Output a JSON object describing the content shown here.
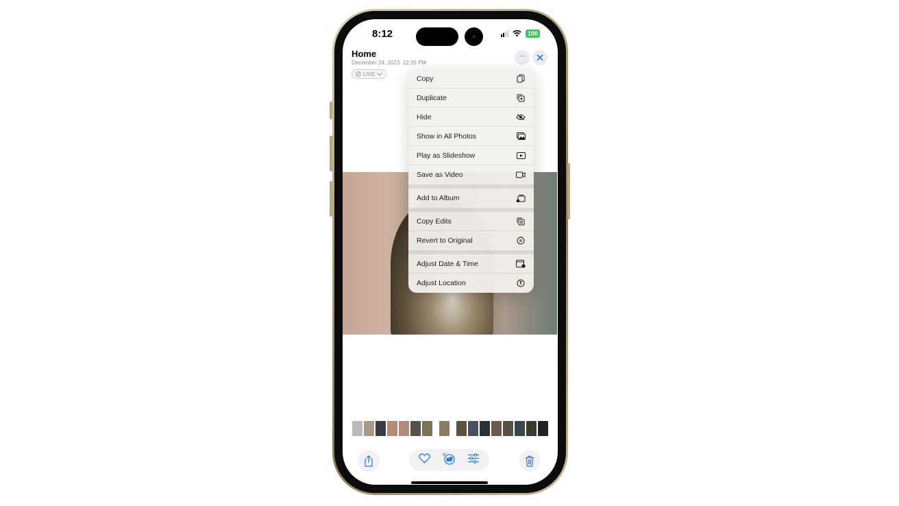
{
  "status_bar": {
    "time": "8:12",
    "battery": "100",
    "battery_color": "#34c759"
  },
  "header": {
    "title": "Home",
    "date": "December 24, 2023",
    "time": "12:26 PM",
    "live_label": "LIVE",
    "more_icon": "ellipsis-icon",
    "close_icon": "close-icon"
  },
  "menu": {
    "groups": [
      [
        {
          "label": "Copy",
          "icon": "copy-icon"
        },
        {
          "label": "Duplicate",
          "icon": "duplicate-icon"
        },
        {
          "label": "Hide",
          "icon": "eye-slash-icon"
        },
        {
          "label": "Show in All Photos",
          "icon": "photos-icon"
        },
        {
          "label": "Play as Slideshow",
          "icon": "play-rectangle-icon"
        },
        {
          "label": "Save as Video",
          "icon": "video-icon"
        }
      ],
      [
        {
          "label": "Add to Album",
          "icon": "add-album-icon"
        }
      ],
      [
        {
          "label": "Copy Edits",
          "icon": "copy-edits-icon"
        },
        {
          "label": "Revert to Original",
          "icon": "revert-icon"
        }
      ],
      [
        {
          "label": "Adjust Date & Time",
          "icon": "calendar-clock-icon"
        },
        {
          "label": "Adjust Location",
          "icon": "location-info-icon"
        }
      ]
    ]
  },
  "filmstrip": {
    "thumb_colors": [
      "#b9b9b9",
      "#a89a84",
      "#3a3c44",
      "#b78a78",
      "#b08a7c",
      "#56524a",
      "#7c725a",
      "#8a7c62",
      "#5e5240",
      "#4a5060",
      "#2c3038",
      "#6a5c48",
      "#565044",
      "#3c4450",
      "#3a3a2e",
      "#222222"
    ],
    "gap_before_indices": [
      7,
      8
    ]
  },
  "toolbar": {
    "share_icon": "share-icon",
    "favorite_icon": "heart-icon",
    "visual_lookup_icon": "visual-lookup-pet-icon",
    "edit_icon": "sliders-icon",
    "delete_icon": "trash-icon",
    "accent_color": "#2f7bd6"
  }
}
